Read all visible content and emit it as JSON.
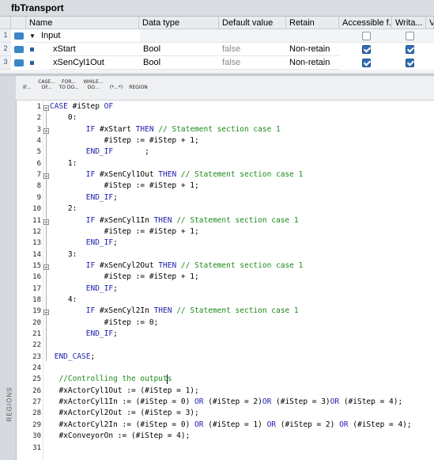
{
  "window": {
    "title": "fbTransport"
  },
  "interface": {
    "columns": [
      "Name",
      "Data type",
      "Default value",
      "Retain",
      "Accessible f...",
      "Writa...",
      "V"
    ],
    "rows": [
      {
        "num": "1",
        "name": "Input",
        "type": "",
        "default": "",
        "retain": "",
        "accessible": false,
        "writable": false
      },
      {
        "num": "2",
        "name": "xStart",
        "type": "Bool",
        "default": "false",
        "retain": "Non-retain",
        "accessible": true,
        "writable": true
      },
      {
        "num": "3",
        "name": "xSenCyl1Out",
        "type": "Bool",
        "default": "false",
        "retain": "Non-retain",
        "accessible": true,
        "writable": true
      }
    ]
  },
  "toolbar": {
    "buttons": [
      {
        "l1": "IF...",
        "l2": ""
      },
      {
        "l1": "CASE...",
        "l2": "OF..."
      },
      {
        "l1": "FOR...",
        "l2": "TO DO..."
      },
      {
        "l1": "WHILE...",
        "l2": "DO..."
      },
      {
        "l1": "(*...*)",
        "l2": ""
      },
      {
        "l1": "REGION",
        "l2": ""
      }
    ]
  },
  "regions_label": "REGIONS",
  "code_lines": [
    [
      [
        "kw",
        "CASE "
      ],
      [
        "t",
        "#iStep "
      ],
      [
        "kw",
        "OF"
      ]
    ],
    [
      [
        "t",
        "    0:"
      ]
    ],
    [
      [
        "t",
        "        "
      ],
      [
        "kw",
        "IF "
      ],
      [
        "t",
        "#xStart "
      ],
      [
        "kw",
        "THEN "
      ],
      [
        "cm",
        "// Statement section case 1"
      ]
    ],
    [
      [
        "t",
        "            #iStep := #iStep + 1;"
      ]
    ],
    [
      [
        "t",
        "        "
      ],
      [
        "kw",
        "END_IF"
      ],
      [
        "t",
        "       ;"
      ]
    ],
    [
      [
        "t",
        "    1:"
      ]
    ],
    [
      [
        "t",
        "        "
      ],
      [
        "kw",
        "IF "
      ],
      [
        "t",
        "#xSenCyl1Out "
      ],
      [
        "kw",
        "THEN "
      ],
      [
        "cm",
        "// Statement section case 1"
      ]
    ],
    [
      [
        "t",
        "            #iStep := #iStep + 1;"
      ]
    ],
    [
      [
        "t",
        "        "
      ],
      [
        "kw",
        "END_IF"
      ],
      [
        "t",
        ";"
      ]
    ],
    [
      [
        "t",
        "    2:"
      ]
    ],
    [
      [
        "t",
        "        "
      ],
      [
        "kw",
        "IF "
      ],
      [
        "t",
        "#xSenCyl1In "
      ],
      [
        "kw",
        "THEN "
      ],
      [
        "cm",
        "// Statement section case 1"
      ]
    ],
    [
      [
        "t",
        "            #iStep := #iStep + 1;"
      ]
    ],
    [
      [
        "t",
        "        "
      ],
      [
        "kw",
        "END_IF"
      ],
      [
        "t",
        ";"
      ]
    ],
    [
      [
        "t",
        "    3:"
      ]
    ],
    [
      [
        "t",
        "        "
      ],
      [
        "kw",
        "IF "
      ],
      [
        "t",
        "#xSenCyl2Out "
      ],
      [
        "kw",
        "THEN "
      ],
      [
        "cm",
        "// Statement section case 1"
      ]
    ],
    [
      [
        "t",
        "            #iStep := #iStep + 1;"
      ]
    ],
    [
      [
        "t",
        "        "
      ],
      [
        "kw",
        "END_IF"
      ],
      [
        "t",
        ";"
      ]
    ],
    [
      [
        "t",
        "    4:"
      ]
    ],
    [
      [
        "t",
        "        "
      ],
      [
        "kw",
        "IF "
      ],
      [
        "t",
        "#xSenCyl2In "
      ],
      [
        "kw",
        "THEN "
      ],
      [
        "cm",
        "// Statement section case 1"
      ]
    ],
    [
      [
        "t",
        "            #iStep := 0;"
      ]
    ],
    [
      [
        "t",
        "        "
      ],
      [
        "kw",
        "END_IF"
      ],
      [
        "t",
        ";"
      ]
    ],
    [
      [
        "t",
        ""
      ]
    ],
    [
      [
        "t",
        " "
      ],
      [
        "kw",
        "END_CASE"
      ],
      [
        "t",
        ";"
      ]
    ],
    [
      [
        "t",
        ""
      ]
    ],
    [
      [
        "t",
        "  "
      ],
      [
        "cm",
        "//Controlling the outputs"
      ]
    ],
    [
      [
        "t",
        "  #xActorCyl1Out := (#iStep = 1);"
      ]
    ],
    [
      [
        "t",
        "  #xActorCyl1In := (#iStep = 0) "
      ],
      [
        "kw",
        "OR"
      ],
      [
        "t",
        " (#iStep = 2)"
      ],
      [
        "kw",
        "OR"
      ],
      [
        "t",
        " (#iStep = 3)"
      ],
      [
        "kw",
        "OR"
      ],
      [
        "t",
        " (#iStep = 4);"
      ]
    ],
    [
      [
        "t",
        "  #xActorCyl2Out := (#iStep = 3);"
      ]
    ],
    [
      [
        "t",
        "  #xActorCyl2In := (#iStep = 0) "
      ],
      [
        "kw",
        "OR"
      ],
      [
        "t",
        " (#iStep = 1) "
      ],
      [
        "kw",
        "OR"
      ],
      [
        "t",
        " (#iStep = 2) "
      ],
      [
        "kw",
        "OR"
      ],
      [
        "t",
        " (#iStep = 4);"
      ]
    ],
    [
      [
        "t",
        "  #xConveyorOn := (#iStep = 4);"
      ]
    ],
    [
      [
        "t",
        ""
      ]
    ]
  ],
  "colors": {
    "keyword": "#1f1fb0",
    "comment": "#1a8a1a",
    "header_bg": "#e9ecef"
  }
}
